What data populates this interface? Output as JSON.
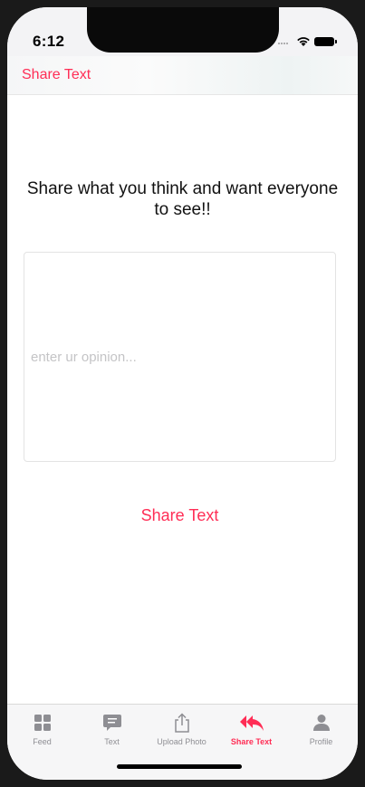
{
  "status": {
    "time": "6:12"
  },
  "nav": {
    "title": "Share Text"
  },
  "main": {
    "heading": "Share what you think and want everyone to see!!",
    "textarea_placeholder": "enter ur opinion...",
    "share_button": "Share Text"
  },
  "tabs": [
    {
      "label": "Feed",
      "icon": "grid-icon",
      "active": false
    },
    {
      "label": "Text",
      "icon": "message-icon",
      "active": false
    },
    {
      "label": "Upload Photo",
      "icon": "share-upload-icon",
      "active": false
    },
    {
      "label": "Share Text",
      "icon": "reply-all-icon",
      "active": true
    },
    {
      "label": "Profile",
      "icon": "person-icon",
      "active": false
    }
  ],
  "colors": {
    "accent": "#ff2d55",
    "inactive": "#8e8e93"
  }
}
